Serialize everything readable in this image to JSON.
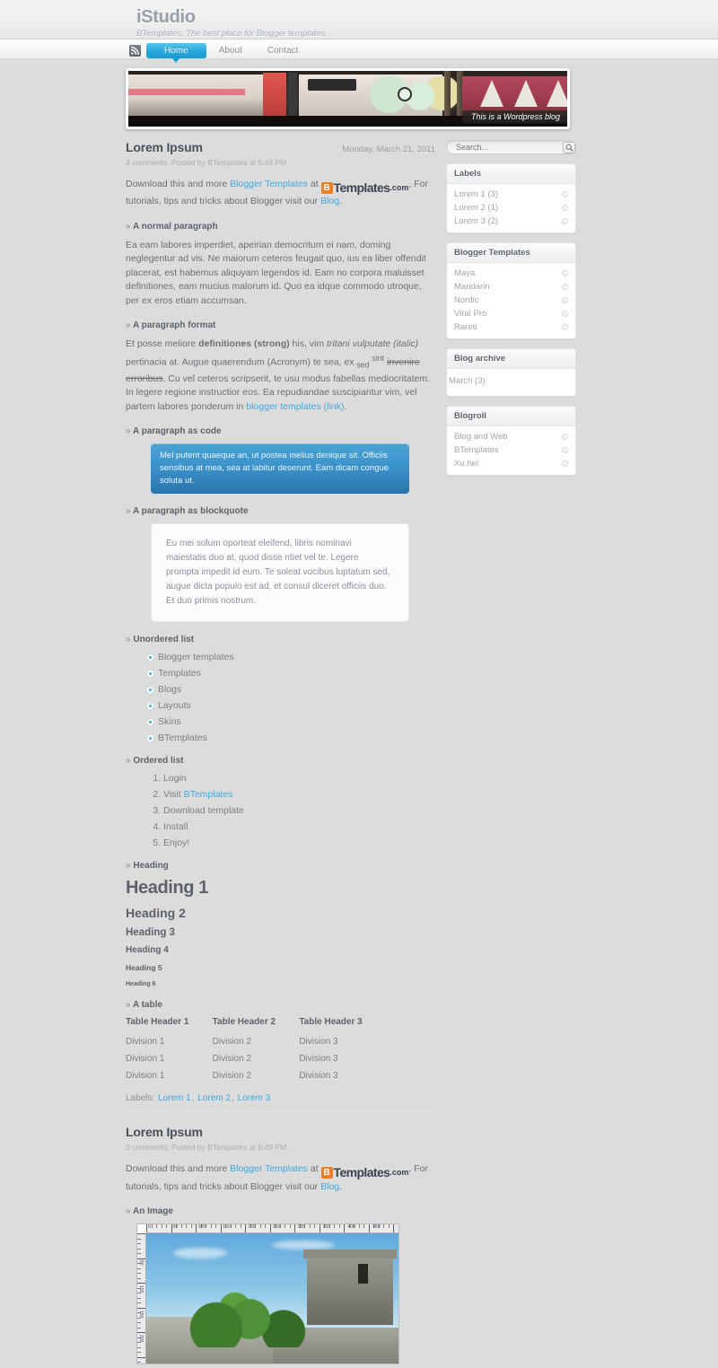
{
  "site": {
    "title": "iStudio",
    "tagline": "BTemplates, The best place for Blogger templates"
  },
  "nav": {
    "rss_icon": "rss-icon",
    "items": [
      {
        "label": "Home",
        "active": true
      },
      {
        "label": "About",
        "active": false
      },
      {
        "label": "Contact",
        "active": false
      }
    ]
  },
  "banner": {
    "caption": "This is a Wordpress blog",
    "alt": "graffiti covered train car"
  },
  "posts": [
    {
      "title": "Lorem Ipsum",
      "date": "Monday, March 21, 2011",
      "meta": "3 comments, Posted by BTemplates at 6:49 PM ,",
      "intro_a": "Download this and more ",
      "intro_link1": "Blogger Templates",
      "intro_b": " at ",
      "logo_b": "B",
      "logo_main": "Templates",
      "logo_com": ".com",
      "intro_c": ", For tutorials, tips and tricks about Blogger visit our ",
      "intro_link2": "Blog",
      "intro_d": ".",
      "sections": {
        "normal_paragraph": "A normal paragraph",
        "normal_paragraph_text": "Ea eam labores imperdiet, apeirian democritum ei nam, doming neglegentur ad vis. Ne maiorum ceteros feugait quo, ius ea liber offendit placerat, est habemus aliquyam legendos id. Eam no corpora maluisset definitiones, eam mucius malorum id. Quo ea idque commodo utroque, per ex eros etiam accumsan.",
        "paragraph_format": "A paragraph format",
        "pf_1": "Et posse meliore ",
        "pf_strong": "definitiones (strong)",
        "pf_2": " his, vim ",
        "pf_italic": "tritani vulputate (italic)",
        "pf_3": " pertinacia at. Augue quaerendum (Acronym) te sea, ex ",
        "pf_sub": "sed",
        "pf_sup": "sint",
        "pf_strike": "invenire erroribus",
        "pf_4": ". Cu vel ceteros scripserit, te usu modus fabellas mediocritatem. In legere regione instructior eos. Ea repudiandae suscipiantur vim, vel partem labores ponderum in ",
        "pf_link": "blogger templates (link)",
        "pf_5": ".",
        "code_heading": "A paragraph as code",
        "code_text": "Mel putent quaeque an, ut postea melius denique sit. Officiis sensibus at mea, sea at labitur deserunt. Eam dicam congue soluta ut.",
        "quote_heading": "A paragraph as blockquote",
        "quote_text": "Eu mei solum oporteat eleifend, libris nominavi maiestatis duo at, quod disse ntiet vel te. Legere prompta impedit id eum. Te soleat vocibus luptatum sed, augue dicta populo est ad, et consul diceret officiis duo. Et duo primis nostrum.",
        "ul_heading": "Unordered list",
        "ol_heading": "Ordered list",
        "heading_heading": "Heading",
        "table_heading": "A table"
      },
      "unordered_list": [
        "Blogger templates",
        "Templates",
        "Blogs",
        "Layouts",
        "Skins",
        "BTemplates"
      ],
      "ordered_list_1": "Login",
      "ordered_list_2_pre": "Visit ",
      "ordered_list_2_link": "BTemplates",
      "ordered_list_3": "Download template",
      "ordered_list_4": "Install",
      "ordered_list_5": "Enjoy!",
      "headings": [
        "Heading 1",
        "Heading 2",
        "Heading 3",
        "Heading 4",
        "Heading 5",
        "Heading 6"
      ],
      "table": {
        "headers": [
          "Table Header 1",
          "Table Header 2",
          "Table Header 3"
        ],
        "rows": [
          [
            "Division 1",
            "Division 2",
            "Division 3"
          ],
          [
            "Division 1",
            "Division 2",
            "Division 3"
          ],
          [
            "Division 1",
            "Division 2",
            "Division 3"
          ]
        ]
      },
      "labels_prefix": "Labels:",
      "labels": [
        "Lorem 1",
        "Lorem 2",
        "Lorem 3"
      ],
      "label_sep": ","
    },
    {
      "title": "Lorem Ipsum",
      "meta": "0 comments, Posted by BTemplates at 6:49 PM ,",
      "intro_a": "Download this and more ",
      "intro_link1": "Blogger Templates",
      "intro_b": " at ",
      "logo_b": "B",
      "logo_main": "Templates",
      "logo_com": ".com",
      "intro_c": ", For tutorials, tips and tricks about Blogger visit our ",
      "intro_link2": "Blog",
      "intro_d": ".",
      "image_heading": "An Image",
      "image_alt": "Mayan ruins at Tulum overlooking the Caribbean sea"
    }
  ],
  "sidebar": {
    "search": {
      "placeholder": "Search...",
      "value": "",
      "icon": "magnifier-icon"
    },
    "widgets": [
      {
        "title": "Labels",
        "items": [
          "Lorem 1 (3)",
          "Lorem 2 (1)",
          "Lorem 3 (2)"
        ]
      },
      {
        "title": "Blogger Templates",
        "items": [
          "Maya",
          "Mandarin",
          "Nordic",
          "Viral Pro",
          "Rareti"
        ]
      },
      {
        "title": "Blog archive",
        "plain_items": [
          "March (3)"
        ]
      },
      {
        "title": "Blogroll",
        "items": [
          "Blog and Web",
          "BTemplates",
          "Xu.hel"
        ]
      }
    ]
  },
  "colors": {
    "accent": "#3fa9dd",
    "nav_active": "#2aa9dd",
    "code_bg": "#3b93cb",
    "orange": "#f07e22",
    "page_bg": "#dcdcdc",
    "text": "#6a6f76"
  },
  "ruler": {
    "h_labels": [
      "0",
      "50",
      "100",
      "150",
      "200",
      "250",
      "300",
      "350",
      "400",
      "450"
    ],
    "v_labels": [
      "50",
      "100",
      "150",
      "200"
    ]
  }
}
